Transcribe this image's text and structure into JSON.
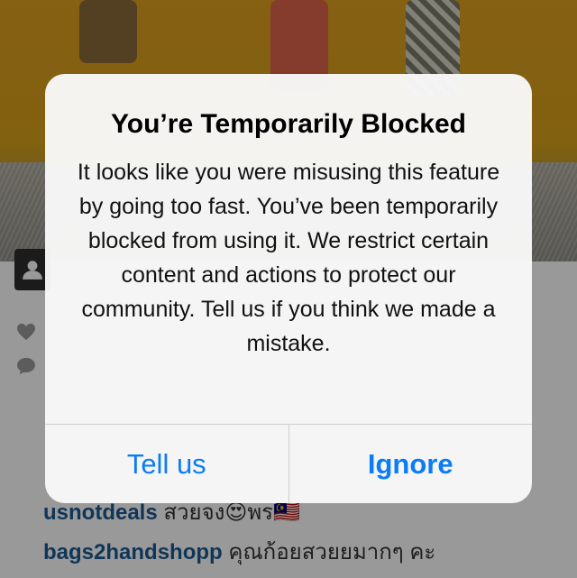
{
  "alert": {
    "title": "You’re Temporarily Blocked",
    "message": "It looks like you were misusing this feature by going too fast. You’ve been temporarily blocked from using it. We restrict certain content and actions to protect our community. Tell us if you think we made a mistake.",
    "buttons": {
      "tell_us": "Tell us",
      "ignore": "Ignore"
    }
  },
  "feed": {
    "comments": [
      {
        "username": "usnotdeals",
        "text": "สวยจง😍พร🇲🇾"
      },
      {
        "username": "bags2handshopp",
        "text": "คุณก้อยสวยยมากๆ คะ"
      }
    ],
    "icons": [
      "user-tag-icon",
      "heart-icon",
      "comment-icon"
    ]
  },
  "colors": {
    "link_blue": "#0b7cf6",
    "username_blue": "#1c5b92",
    "alert_background": "#f8f8f8",
    "photo_yellow": "#e0a020"
  }
}
